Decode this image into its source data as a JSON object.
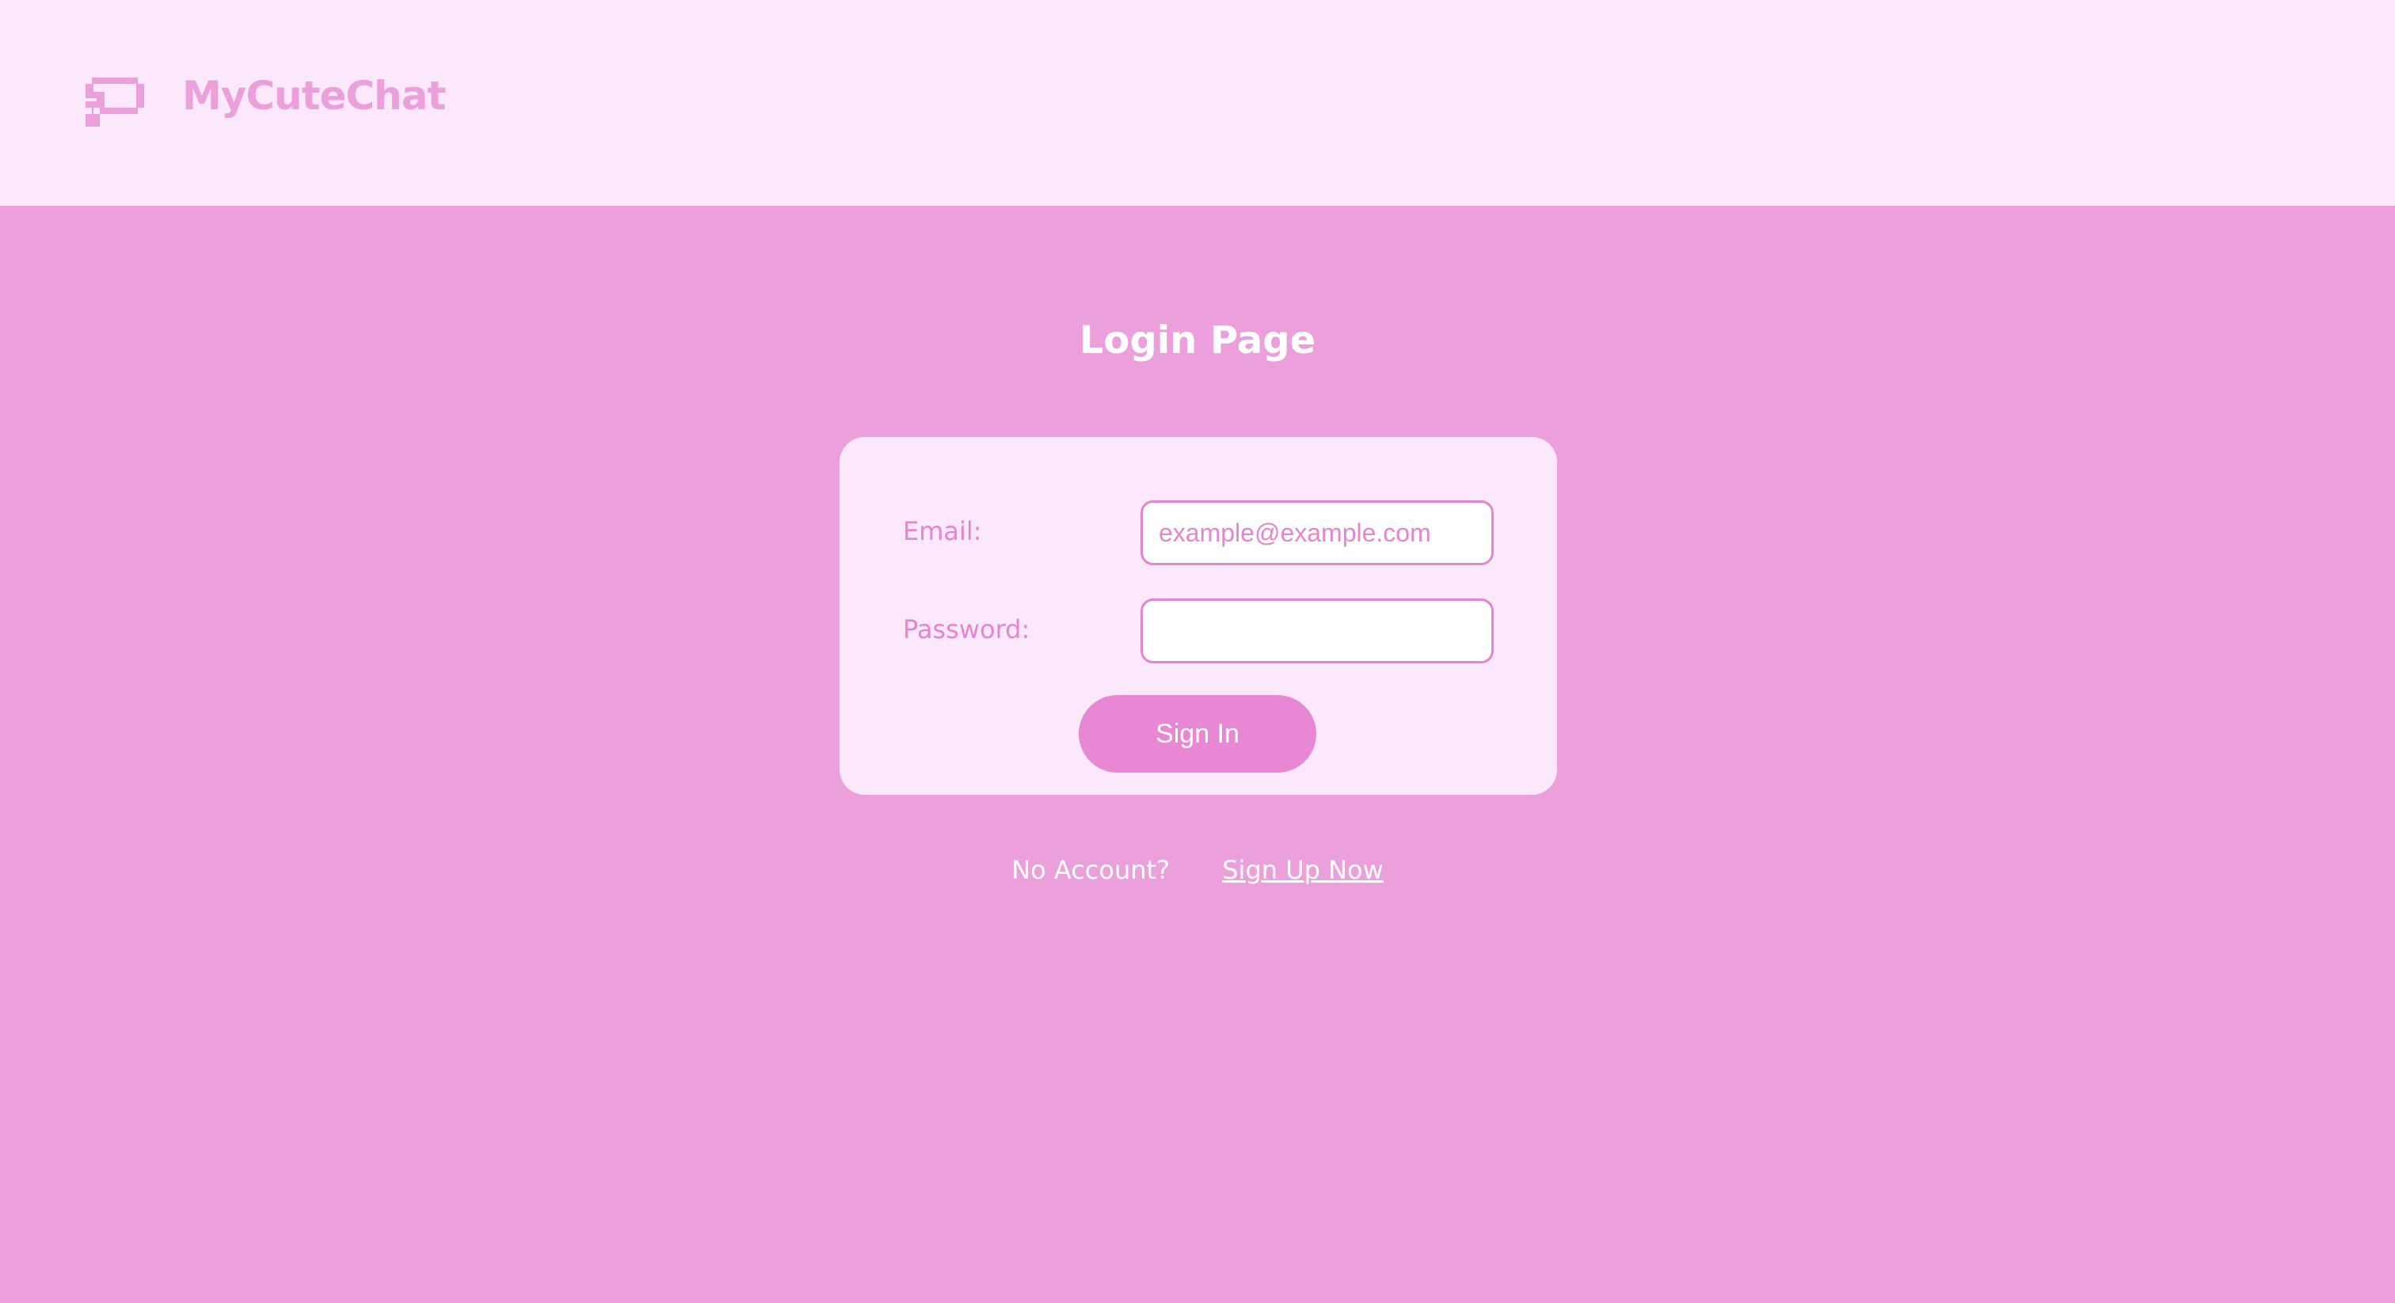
{
  "header": {
    "logo_icon": "chat-bubble-icon",
    "brand_name": "MyCuteChat"
  },
  "colors": {
    "background": "#eba0dc",
    "header_background": "#fbe9fb",
    "card_background": "#fbe9fb",
    "accent": "#e585d2",
    "button": "#e887d4",
    "text_light": "#ffffff"
  },
  "login": {
    "title": "Login Page",
    "email_label": "Email:",
    "email_value": "",
    "email_placeholder": "example@example.com",
    "password_label": "Password:",
    "password_value": "",
    "sign_in_label": "Sign In"
  },
  "signup": {
    "prompt": "No Account?",
    "link_label": "Sign Up Now"
  }
}
